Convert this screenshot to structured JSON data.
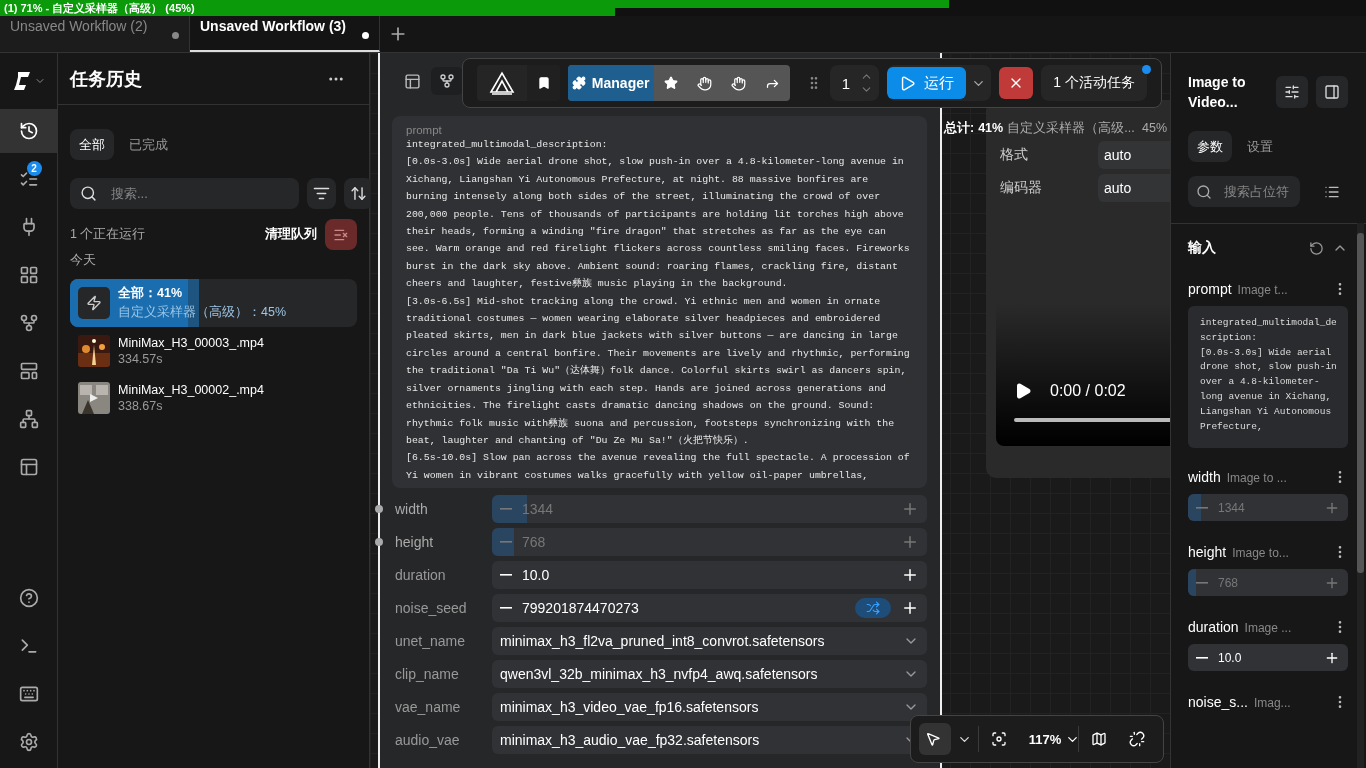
{
  "progress_bar": {
    "title": "(1) 71% - 自定义采样器（高级） (45%)",
    "level": 0.71
  },
  "tabs": [
    {
      "label": "Unsaved Workflow (2)",
      "selected": false,
      "modified": true
    },
    {
      "label": "Unsaved Workflow (3)",
      "selected": true,
      "modified": true
    }
  ],
  "rail": {
    "top": [
      {
        "kind": "history",
        "selected": true
      },
      {
        "kind": "queue",
        "selected": false,
        "badge": "2"
      },
      {
        "kind": "plug",
        "selected": false
      },
      {
        "kind": "nodes",
        "selected": false
      },
      {
        "kind": "workflow",
        "selected": false
      },
      {
        "kind": "templates",
        "selected": false
      },
      {
        "kind": "hierarchy",
        "selected": false
      },
      {
        "kind": "layouts",
        "selected": false
      }
    ],
    "bottom": [
      {
        "kind": "help",
        "selected": false
      },
      {
        "kind": "terminal",
        "selected": false
      },
      {
        "kind": "keyboard",
        "selected": false
      },
      {
        "kind": "settings",
        "selected": false
      }
    ]
  },
  "history_panel": {
    "title": "任务历史",
    "tabs": [
      {
        "label": "全部",
        "selected": true
      },
      {
        "label": "已完成",
        "selected": false
      }
    ],
    "search": {
      "placeholder": "搜索..."
    },
    "running_count": "1 个正在运行",
    "clear_label": "清理队列",
    "group": "今天",
    "running": {
      "title": "全部：41%",
      "subtitle": "自定义采样器（高级）：45%",
      "level": 0.41,
      "node_progress": {
        "level": 0.45
      }
    },
    "items": [
      {
        "name": "MiniMax_H3_00003_.mp4",
        "duration": "334.57s"
      },
      {
        "name": "MiniMax_H3_00002_.mp4",
        "duration": "338.67s"
      }
    ]
  },
  "node": {
    "prompt_label": "prompt",
    "prompt": "integrated_multimodal_description:\n[0.0s-3.0s] Wide aerial drone shot, slow push-in over a 4.8-kilometer-long avenue in Xichang, Liangshan Yi Autonomous Prefecture, at night. 88 massive bonfires are burning intensely along both sides of the street, illuminating the crowd of over 200,000 people. Tens of thousands of participants are holding lit torches high above their heads, forming a winding \"fire dragon\" that stretches as far as the eye can see. Warm orange and red firelight flickers across countless smiling faces. Fireworks burst in the dark sky above. Ambient sound: roaring flames, crackling fire, distant cheers and laughter, festive彝族 music playing in the background.\n[3.0s-6.5s] Mid-shot tracking along the crowd. Yi ethnic men and women in ornate traditional costumes — women wearing elaborate silver headpieces and embroidered pleated skirts, men in dark blue jackets with silver buttons — are dancing in large circles around a central bonfire. Their movements are lively and rhythmic, performing the traditional \"Da Ti Wu\"（达体舞）folk dance. Colorful skirts swirl as dancers spin, silver ornaments jingling with each step. Hands are joined across generations and ethnicities. The firelight casts dramatic dancing shadows on the ground. Sound: rhythmic folk music with彝族 suona and percussion, footsteps synchronizing with the beat, laughter and chanting of \"Du Ze Mu Sa!\"（火把节快乐）.\n[6.5s-10.0s] Slow pan across the avenue revealing the full spectacle. A procession of Yi women in vibrant costumes walks gracefully with yellow oil-paper umbrellas,",
    "widgets": [
      {
        "kind": "number",
        "name": "width",
        "value": "1344",
        "level": 0.08,
        "linked": true
      },
      {
        "kind": "number",
        "name": "height",
        "value": "768",
        "level": 0.05,
        "linked": true
      },
      {
        "kind": "number",
        "name": "duration",
        "value": "10.0",
        "linked": false
      },
      {
        "kind": "seed",
        "name": "noise_seed",
        "value": "799201874470273",
        "linked": false
      },
      {
        "kind": "combo",
        "name": "unet_name",
        "value": "minimax_h3_fl2va_pruned_int8_convrot.safetensors",
        "linked": false
      },
      {
        "kind": "combo",
        "name": "clip_name",
        "value": "qwen3vl_32b_minimax_h3_nvfp4_awq.safetensors",
        "linked": false
      },
      {
        "kind": "combo",
        "name": "vae_name",
        "value": "minimax_h3_video_vae_fp16.safetensors",
        "linked": false
      },
      {
        "kind": "combo",
        "name": "audio_vae",
        "value": "minimax_h3_audio_vae_fp32.safetensors",
        "linked": false
      }
    ]
  },
  "toolbar": {
    "manager": "Manager",
    "batch": "1",
    "run": "运行",
    "active": "1 个活动任务"
  },
  "output_node": {
    "progress": {
      "total_label": "总计:",
      "total": "41%",
      "node": "自定义采样器（高级...",
      "node_pct": "45%"
    },
    "fields": [
      {
        "label": "格式",
        "value": "auto"
      },
      {
        "label": "编码器",
        "value": "auto"
      }
    ],
    "video": {
      "time": "0:00 / 0:02"
    }
  },
  "canvas_tools": {
    "zoom": "117%",
    "pointer_selected": true
  },
  "right_panel": {
    "title": "Image to Video...",
    "tabs": [
      {
        "label": "参数",
        "selected": true
      },
      {
        "label": "设置",
        "selected": false
      }
    ],
    "search": {
      "placeholder": "搜索占位符"
    },
    "section": "输入",
    "widgets": [
      {
        "kind": "text",
        "name": "prompt",
        "source": "Image t...",
        "value": "integrated_multimodal_description:\n[0.0s-3.0s] Wide aerial drone shot, slow push-in over a 4.8-kilometer-long avenue in Xichang, Liangshan Yi Autonomous Prefecture,"
      },
      {
        "kind": "number",
        "name": "width",
        "source": "Image to ...",
        "value": "1344",
        "level": 0.08,
        "linked": true
      },
      {
        "kind": "number",
        "name": "height",
        "source": "Image to...",
        "value": "768",
        "level": 0.05,
        "linked": true
      },
      {
        "kind": "number",
        "name": "duration",
        "source": "Image ...",
        "value": "10.0",
        "linked": false
      },
      {
        "kind": "header",
        "name": "noise_s...",
        "source": "Imag..."
      }
    ]
  }
}
